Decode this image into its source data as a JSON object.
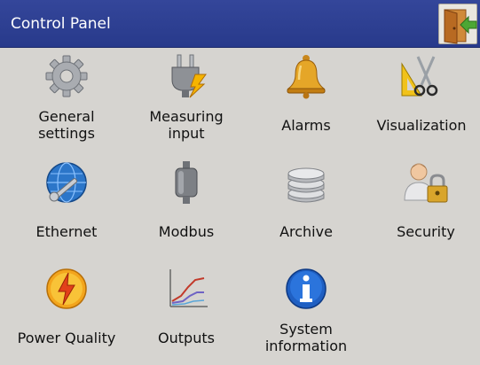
{
  "header": {
    "title": "Control Panel",
    "exit_icon": "exit-door-icon"
  },
  "tiles": [
    {
      "label": "General\nsettings",
      "icon": "gear-icon"
    },
    {
      "label": "Measuring\ninput",
      "icon": "plug-icon"
    },
    {
      "label": "Alarms",
      "icon": "bell-icon"
    },
    {
      "label": "Visualization",
      "icon": "drawing-tools-icon"
    },
    {
      "label": "Ethernet",
      "icon": "globe-wrench-icon"
    },
    {
      "label": "Modbus",
      "icon": "modbus-module-icon"
    },
    {
      "label": "Archive",
      "icon": "database-icon"
    },
    {
      "label": "Security",
      "icon": "user-lock-icon"
    },
    {
      "label": "Power Quality",
      "icon": "lightning-icon"
    },
    {
      "label": "Outputs",
      "icon": "chart-lines-icon"
    },
    {
      "label": "System\ninformation",
      "icon": "info-icon"
    }
  ],
  "colors": {
    "header_bg": "#2e3f92",
    "background": "#d6d4d0",
    "text": "#111111"
  }
}
